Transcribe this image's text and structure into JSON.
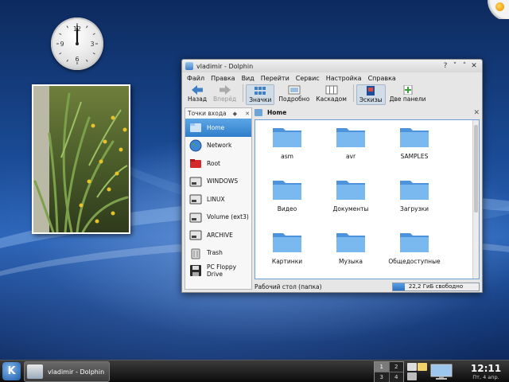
{
  "window": {
    "title": "vladimir - Dolphin",
    "menu": [
      "Файл",
      "Правка",
      "Вид",
      "Перейти",
      "Сервис",
      "Настройка",
      "Справка"
    ],
    "toolbar": {
      "back": "Назад",
      "forward": "Вперёд",
      "icons": "Значки",
      "details": "Подробно",
      "columns": "Каскадом",
      "preview": "Эскизы",
      "split": "Две панели"
    },
    "places": {
      "title": "Точки входа",
      "items": [
        {
          "label": "Home",
          "icon": "home-icon",
          "selected": true
        },
        {
          "label": "Network",
          "icon": "network-icon"
        },
        {
          "label": "Root",
          "icon": "root-folder-icon"
        },
        {
          "label": "WINDOWS",
          "icon": "drive-icon"
        },
        {
          "label": "LINUX",
          "icon": "drive-icon"
        },
        {
          "label": "Volume (ext3)",
          "icon": "drive-icon"
        },
        {
          "label": "ARCHIVE",
          "icon": "drive-icon"
        },
        {
          "label": "Trash",
          "icon": "trash-icon"
        },
        {
          "label": "PC Floppy Drive",
          "icon": "floppy-icon"
        }
      ]
    },
    "breadcrumb": "Home",
    "folders": [
      "asm",
      "avr",
      "SAMPLES",
      "Видео",
      "Документы",
      "Загрузки",
      "Картинки",
      "Музыка",
      "Общедоступные"
    ],
    "status": "Рабочий стол (папка)",
    "free_space": "22,2 ГиБ свободно",
    "free_space_used_fraction": 0.14
  },
  "taskbar": {
    "kmenu": "K",
    "task": "vladimir - Dolphin",
    "pager": [
      "1",
      "2",
      "3",
      "4"
    ],
    "current_desktop": "1",
    "time": "12:11",
    "date": "Пт, 4 апр."
  },
  "clock_widget": {
    "numerals": [
      "12",
      "3",
      "6",
      "9"
    ],
    "time": "12:00"
  },
  "colors": {
    "selection": "#2f7dcb",
    "folder": "#6aaeea",
    "taskbar": "#1a1a1a"
  }
}
